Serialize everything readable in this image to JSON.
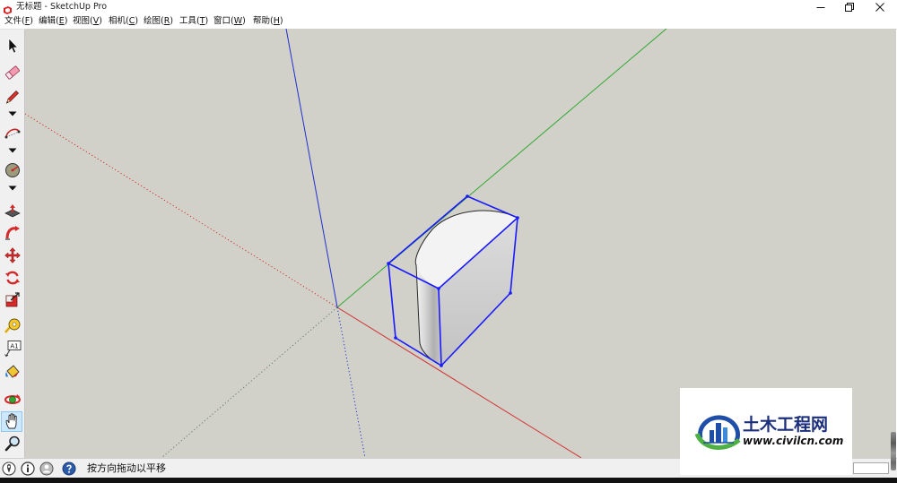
{
  "window": {
    "title": "无标题 - SketchUp Pro",
    "app_icon": "sketchup-logo-icon",
    "controls": [
      "minimize-icon",
      "restore-icon",
      "close-icon"
    ]
  },
  "menu": {
    "items": [
      "文件(F)",
      "编辑(E)",
      "视图(V)",
      "相机(C)",
      "绘图(R)",
      "工具(T)",
      "窗口(W)",
      "帮助(H)"
    ]
  },
  "toolbar": {
    "tools": [
      "select-arrow-icon",
      "eraser-icon",
      "line-pencil-icon",
      "dropdown-arrow-icon",
      "arc-icon",
      "dropdown-arrow-icon",
      "shapes-circle-icon",
      "dropdown-arrow-icon",
      "push-pull-icon",
      "follow-me-icon",
      "move-icon",
      "rotate-icon",
      "scale-icon",
      "tape-measure-icon",
      "text-icon",
      "paint-bucket-icon",
      "orbit-icon",
      "pan-hand-icon",
      "zoom-icon"
    ],
    "active_tool": "pan-hand-icon",
    "text_tool_glyph": "A1"
  },
  "colors": {
    "canvas_background": "#d1d1c9",
    "axis_red": "#d32f2f",
    "axis_green": "#2ea82e",
    "axis_blue": "#1f2fd0",
    "selection": "#1a1aff",
    "active_tool_highlight": "#cce8ff"
  },
  "status_bar": {
    "icons": [
      "geo-location-icon",
      "credits-icon",
      "user-icon",
      "help-icon"
    ],
    "hint": "按方向拖动以平移"
  },
  "watermark": {
    "logo_icon": "civilcn-logo-icon",
    "site_name": "土木工程网",
    "site_url": "www.civilcn.com"
  }
}
